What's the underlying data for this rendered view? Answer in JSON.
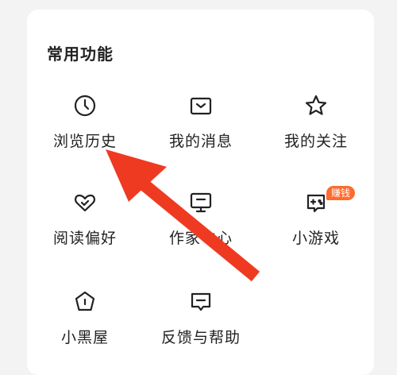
{
  "section": {
    "title": "常用功能"
  },
  "items": [
    {
      "label": "浏览历史",
      "icon": "clock-icon"
    },
    {
      "label": "我的消息",
      "icon": "message-icon"
    },
    {
      "label": "我的关注",
      "icon": "star-icon"
    },
    {
      "label": "阅读偏好",
      "icon": "heart-icon"
    },
    {
      "label": "作家中心",
      "icon": "monitor-icon"
    },
    {
      "label": "小游戏",
      "icon": "gamepad-icon",
      "badge": "赚钱"
    },
    {
      "label": "小黑屋",
      "icon": "pentagon-alert-icon"
    },
    {
      "label": "反馈与帮助",
      "icon": "feedback-icon"
    }
  ],
  "colors": {
    "accent": "#ff6a2e",
    "arrow": "#ef3a22",
    "text": "#222222",
    "background": "#f3f3f3"
  }
}
